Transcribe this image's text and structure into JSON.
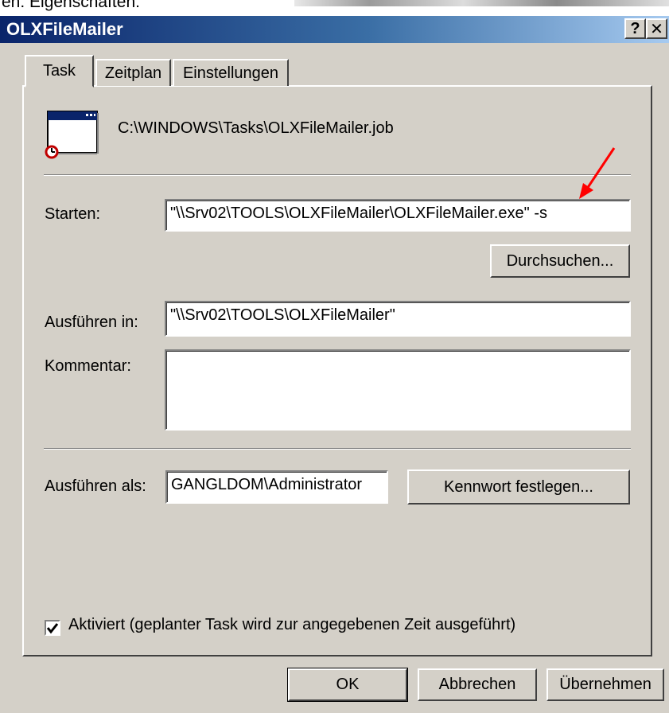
{
  "header_snippet": "en: Eigenschaften:",
  "window": {
    "title": "OLXFileMailer",
    "help_glyph": "?",
    "close_glyph": "✕"
  },
  "tabs": [
    {
      "label": "Task",
      "active": true
    },
    {
      "label": "Zeitplan",
      "active": false
    },
    {
      "label": "Einstellungen",
      "active": false
    }
  ],
  "task": {
    "icon": "scheduled-task-icon",
    "path": "C:\\WINDOWS\\Tasks\\OLXFileMailer.job",
    "start_label": "Starten:",
    "start_value": "\"\\\\Srv02\\TOOLS\\OLXFileMailer\\OLXFileMailer.exe\" -s",
    "browse_label": "Durchsuchen...",
    "workdir_label": "Ausführen in:",
    "workdir_value": "\"\\\\Srv02\\TOOLS\\OLXFileMailer\"",
    "comment_label": "Kommentar:",
    "comment_value": "",
    "runas_label": "Ausführen als:",
    "runas_value": "GANGLDOM\\Administrator",
    "set_password_label": "Kennwort festlegen...",
    "enabled_label": "Aktiviert (geplanter Task wird zur angegebenen Zeit ausgeführt)",
    "enabled": true
  },
  "buttons": {
    "ok": "OK",
    "cancel": "Abbrechen",
    "apply": "Übernehmen"
  },
  "colors": {
    "title_start": "#0a246a",
    "title_end": "#a6caf0",
    "dialog_bg": "#d4d0c8",
    "annotation_arrow": "#ff0000"
  }
}
